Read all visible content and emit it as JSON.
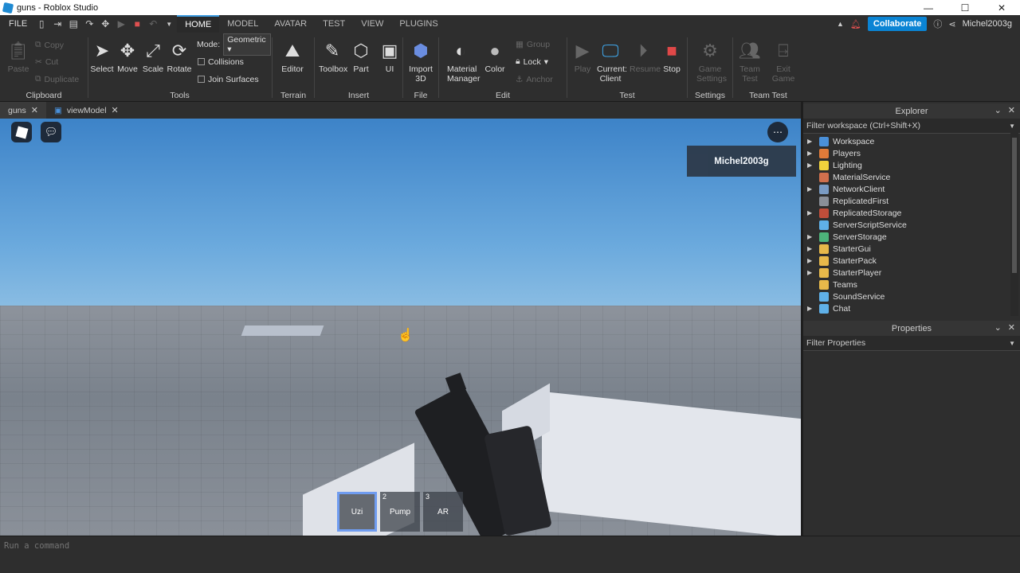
{
  "window": {
    "title": "guns - Roblox Studio",
    "minimize": "—",
    "maximize": "☐",
    "close": "✕"
  },
  "menubar": {
    "file": "FILE",
    "tabs": [
      "HOME",
      "MODEL",
      "AVATAR",
      "TEST",
      "VIEW",
      "PLUGINS"
    ],
    "active_tab": "HOME",
    "collaborate": "Collaborate",
    "username": "Michel2003g"
  },
  "ribbon": {
    "clipboard": {
      "label": "Clipboard",
      "paste": "Paste",
      "copy": "Copy",
      "cut": "Cut",
      "duplicate": "Duplicate"
    },
    "tools": {
      "label": "Tools",
      "select": "Select",
      "move": "Move",
      "scale": "Scale",
      "rotate": "Rotate",
      "mode_label": "Mode:",
      "mode_value": "Geometric",
      "collisions": "Collisions",
      "join_surfaces": "Join Surfaces"
    },
    "terrain": {
      "label": "Terrain",
      "editor": "Editor"
    },
    "insert": {
      "label": "Insert",
      "toolbox": "Toolbox",
      "part": "Part",
      "ui": "UI"
    },
    "file": {
      "label": "File",
      "import3d_line1": "Import",
      "import3d_line2": "3D"
    },
    "edit": {
      "label": "Edit",
      "material_line1": "Material",
      "material_line2": "Manager",
      "color": "Color",
      "group": "Group",
      "lock": "Lock",
      "anchor": "Anchor"
    },
    "test": {
      "label": "Test",
      "play": "Play",
      "current_line1": "Current:",
      "current_line2": "Client",
      "resume": "Resume",
      "stop": "Stop"
    },
    "settings": {
      "label": "Settings",
      "game_line1": "Game",
      "game_line2": "Settings"
    },
    "teamtest": {
      "label": "Team Test",
      "team_line1": "Team",
      "team_line2": "Test",
      "exit_line1": "Exit",
      "exit_line2": "Game"
    }
  },
  "doc_tabs": [
    {
      "label": "guns"
    },
    {
      "label": "viewModel"
    }
  ],
  "viewport": {
    "player_name": "Michel2003g",
    "hotbar": [
      {
        "num": "",
        "label": "Uzi"
      },
      {
        "num": "2",
        "label": "Pump"
      },
      {
        "num": "3",
        "label": "AR"
      }
    ]
  },
  "explorer": {
    "title": "Explorer",
    "filter": "Filter workspace (Ctrl+Shift+X)",
    "items": [
      {
        "label": "Workspace",
        "color": "#4a90d9",
        "arrow": "▶"
      },
      {
        "label": "Players",
        "color": "#e07b39",
        "arrow": "▶"
      },
      {
        "label": "Lighting",
        "color": "#f2d33c",
        "arrow": "▶"
      },
      {
        "label": "MaterialService",
        "color": "#d0704d",
        "arrow": ""
      },
      {
        "label": "NetworkClient",
        "color": "#7a9bc4",
        "arrow": "▶"
      },
      {
        "label": "ReplicatedFirst",
        "color": "#8a8f98",
        "arrow": ""
      },
      {
        "label": "ReplicatedStorage",
        "color": "#c04e3a",
        "arrow": "▶"
      },
      {
        "label": "ServerScriptService",
        "color": "#5fb0e8",
        "arrow": ""
      },
      {
        "label": "ServerStorage",
        "color": "#4db37a",
        "arrow": "▶"
      },
      {
        "label": "StarterGui",
        "color": "#e8b94a",
        "arrow": "▶"
      },
      {
        "label": "StarterPack",
        "color": "#e8b94a",
        "arrow": "▶"
      },
      {
        "label": "StarterPlayer",
        "color": "#e8b94a",
        "arrow": "▶"
      },
      {
        "label": "Teams",
        "color": "#e8b94a",
        "arrow": ""
      },
      {
        "label": "SoundService",
        "color": "#5fb0e8",
        "arrow": ""
      },
      {
        "label": "Chat",
        "color": "#5fb0e8",
        "arrow": "▶"
      }
    ]
  },
  "properties": {
    "title": "Properties",
    "filter": "Filter Properties"
  },
  "command": {
    "placeholder": "Run a command"
  }
}
